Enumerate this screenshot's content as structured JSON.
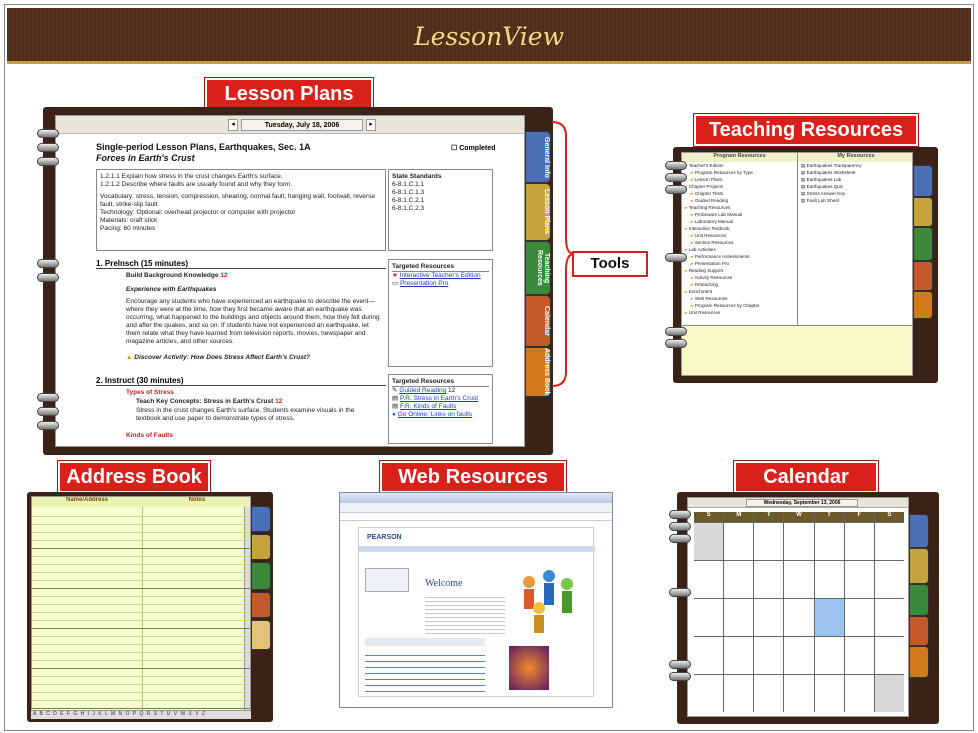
{
  "banner": {
    "title": "LessonView"
  },
  "labels": {
    "lesson_plans": "Lesson Plans",
    "teaching_resources": "Teaching Resources",
    "tools": "Tools",
    "address_book": "Address Book",
    "web_resources": "Web Resources",
    "calendar": "Calendar"
  },
  "lesson": {
    "date": "Tuesday, July 18, 2006",
    "title": "Single-period Lesson Plans, Earthquakes, Sec. 1A",
    "subtitle": "Forces in Earth's Crust",
    "completed": "Completed",
    "objectives": [
      "1.2.1.1 Explain how stress in the crust changes Earth's surface.",
      "1.2.1.2 Describe where faults are usually found and why they form."
    ],
    "vocabulary": "Vocabulary: stress, tension, compression, shearing, normal fault, hanging wall, footwall, reverse fault, strike-slip fault",
    "technology": "Technology: Optional: overhead projector or computer with projector",
    "materials": "Materials: craft stick",
    "pacing": "Pacing: 60 minutes",
    "state_standards_label": "State Standards",
    "state_standards": [
      "6-8.1.C.1.1",
      "6-8.1.C.1.3",
      "6-8.1.C.2.1",
      "6-8.1.C.2.3"
    ],
    "step1": "1. Prelnsch (15 minutes)",
    "step1_sub": "Build Background Knowledge",
    "step1_topic": "Experience with Earthquakes",
    "step1_body": "Encourage any students who have experienced an earthquake to describe the event—where they were at the time, how they first became aware that an earthquake was occurring, what happened to the buildings and objects around them, how they felt during and after the quakes, and so on. If students have not experienced an earthquake, let them relate what they have learned from television reports, movies, newspaper and magazine articles, and other sources.",
    "step1_activity": "Discover Activity: How Does Stress Affect Earth's Crust?",
    "step2": "2. Instruct (30 minutes)",
    "step2_types": "Types of Stress",
    "step2_concept": "Teach Key Concepts: Stress in Earth's Crust",
    "step2_body": "Stress in the crust changes Earth's surface. Students examine visuals in the textbook and use paper to demonstrate types of stress.",
    "step2_kinds": "Kinds of Faults",
    "targeted_label": "Targeted Resources",
    "targeted1": [
      "Interactive Teacher's Edition",
      "Presentation Pro"
    ],
    "targeted2": [
      "Guided Reading",
      "P.R. Stress in Earth's Crust",
      "F.R. Kinds of Faults",
      "Go Online: Links on faults"
    ]
  },
  "lesson_tabs": [
    "General Info",
    "Lesson Plans",
    "Teaching Resources",
    "Calendar",
    "Address Book"
  ],
  "teaching": {
    "left_header": "Program Resources",
    "right_header": "My Resources",
    "left_items": [
      "Teacher's Edition",
      "Program Resources by Type",
      "Lesson Plans",
      "Chapter Projects",
      "Chapter Tests",
      "Guided Reading",
      "Teaching Resources",
      "Probeware Lab Manual",
      "Laboratory Manual",
      "Interactive Textbook",
      "Unit Resources",
      "Section Resources",
      "Lab Activities",
      "Performance Assessments",
      "Presentation Pro",
      "Reading Support",
      "Activity Resources",
      "Reteaching",
      "Enrichment",
      "Web Resources",
      "Program Resources by Chapter",
      "Unit Resources"
    ],
    "right_items": [
      "Earthquakes Transparency",
      "Earthquakes Worksheet",
      "Earthquakes Lab",
      "Earthquakes Quiz",
      "Stress Answer Key",
      "Fault Lab Sheet"
    ]
  },
  "calendar": {
    "header": "Wednesday, September 13, 2006",
    "days": [
      "S",
      "M",
      "T",
      "W",
      "T",
      "F",
      "S"
    ]
  },
  "address": {
    "left_header": "Name/Address",
    "right_header": "Notes"
  },
  "web": {
    "brand": "PEARSON",
    "welcome": "Welcome"
  }
}
